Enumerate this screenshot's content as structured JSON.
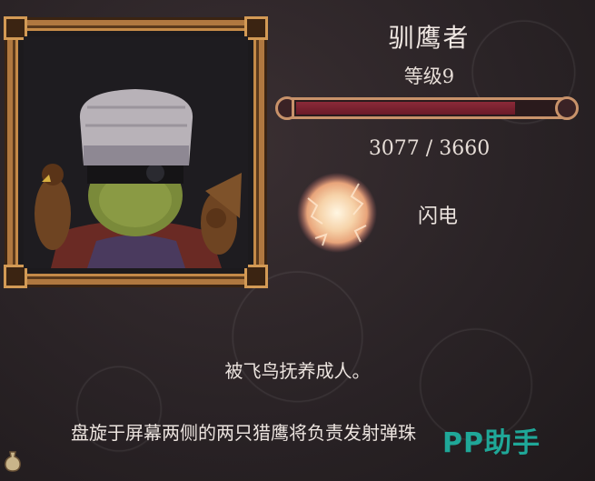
{
  "character": {
    "name": "驯鹰者",
    "level_text": "等级9",
    "xp_current": 3077,
    "xp_max": 3660,
    "xp_text": "3077 / 3660"
  },
  "skill": {
    "name": "闪电",
    "icon": "lightning-orb-icon"
  },
  "description": {
    "line1": "被飞鸟抚养成人。",
    "line2": "盘旋于屏幕两侧的两只猎鹰将负责发射弹珠"
  },
  "watermark": {
    "text": "PP助手"
  },
  "colors": {
    "frame_gold": "#b07840",
    "xp_fill": "#8a2a38",
    "watermark": "#1fb3a3"
  }
}
